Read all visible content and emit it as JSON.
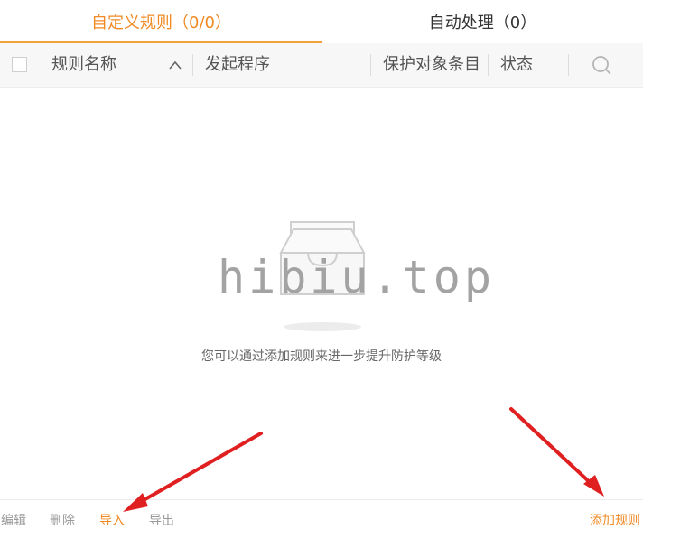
{
  "tabs": [
    {
      "label": "自定义规则（0/0）",
      "active": true
    },
    {
      "label": "自动处理（0）",
      "active": false
    }
  ],
  "table": {
    "columns": [
      "规则名称",
      "发起程序",
      "保护对象条目",
      "状态"
    ],
    "sort_icon": "chevron-up-icon",
    "search_icon": "search-icon"
  },
  "empty": {
    "icon": "empty-box-icon",
    "message": "您可以通过添加规则来进一步提升防护等级"
  },
  "watermark": "hibiu.top",
  "footer": {
    "edit": "编辑",
    "delete": "删除",
    "import": "导入",
    "export": "导出",
    "add_rule": "添加规则"
  },
  "colors": {
    "accent": "#f08a24",
    "arrow": "#e02020"
  }
}
